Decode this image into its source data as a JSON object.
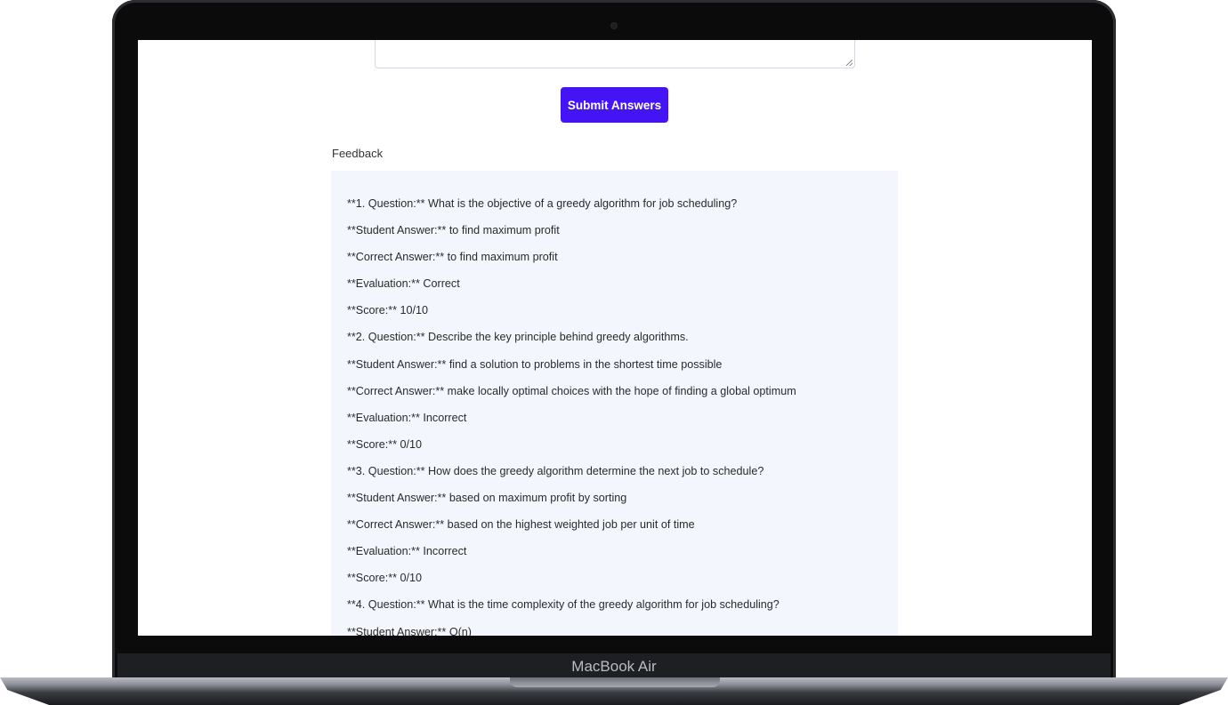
{
  "device": {
    "label": "MacBook Air"
  },
  "form": {
    "submit_label": "Submit Answers"
  },
  "feedback": {
    "heading": "Feedback",
    "lines": [
      "**1. Question:** What is the objective of a greedy algorithm for job scheduling?",
      "**Student Answer:** to find maximum profit",
      "**Correct Answer:** to find maximum profit",
      "**Evaluation:** Correct",
      "**Score:** 10/10",
      "**2. Question:** Describe the key principle behind greedy algorithms.",
      "**Student Answer:** find a solution to problems in the shortest time possible",
      "**Correct Answer:** make locally optimal choices with the hope of finding a global optimum",
      "**Evaluation:** Incorrect",
      "**Score:** 0/10",
      "**3. Question:** How does the greedy algorithm determine the next job to schedule?",
      "**Student Answer:** based on maximum profit by sorting",
      "**Correct Answer:** based on the highest weighted job per unit of time",
      "**Evaluation:** Incorrect",
      "**Score:** 0/10",
      "**4. Question:** What is the time complexity of the greedy algorithm for job scheduling?",
      "**Student Answer:** O(n)"
    ]
  },
  "colors": {
    "accent": "#4514f5",
    "panel_bg": "#f3f6fc"
  }
}
